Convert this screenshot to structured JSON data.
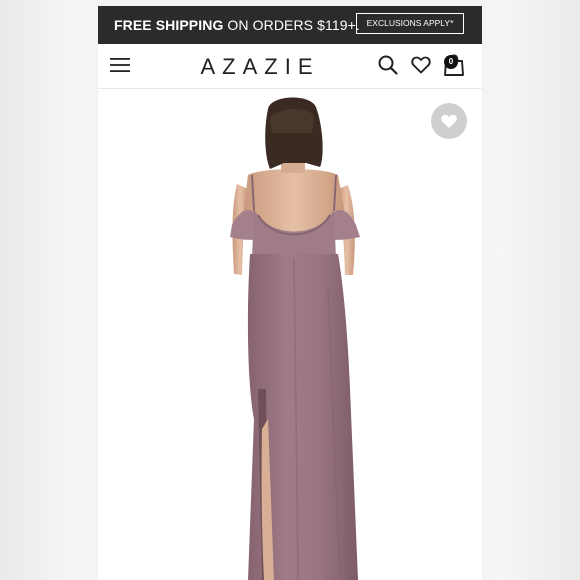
{
  "promo": {
    "bold_text": "FREE SHIPPING",
    "rest_text": " ON ORDERS $119+.",
    "exclusions_label": "EXCLUSIONS APPLY*"
  },
  "header": {
    "logo": "AZAZIE",
    "bag_count": "0"
  },
  "product": {
    "dress_color": "#9c7683",
    "dress_shadow": "#7f5d69",
    "skin_color": "#e2b99e",
    "hair_color": "#3a2a22"
  },
  "icons": {
    "menu": "hamburger-menu-icon",
    "search": "search-icon",
    "wishlist": "heart-icon",
    "bag": "shopping-bag-icon",
    "favorite": "heart-icon"
  }
}
